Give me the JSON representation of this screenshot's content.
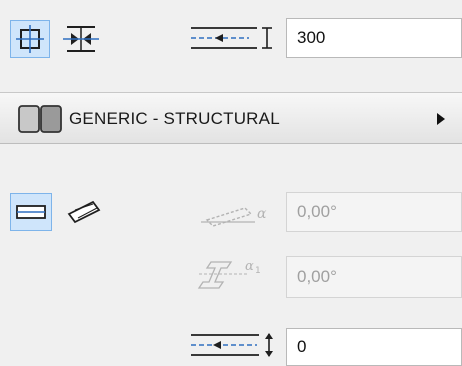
{
  "anchor": {
    "center_icon": "anchor-center-icon",
    "symmetric_icon": "anchor-symmetric-icon"
  },
  "height_field": {
    "icon": "height-dimension-icon",
    "value": "300"
  },
  "profile": {
    "icon": "profile-swatch-icon",
    "label": "GENERIC - STRUCTURAL",
    "menu_icon": "submenu-arrow-icon"
  },
  "orientation": {
    "horizontal_icon": "horizontal-beam-icon",
    "slanted_icon": "slanted-beam-icon"
  },
  "slant_angle": {
    "icon": "slant-angle-icon",
    "value": "0,00°"
  },
  "tilt_angle": {
    "icon": "tilt-angle-icon",
    "value": "0,00°"
  },
  "offset_field": {
    "icon": "offset-dimension-icon",
    "value": "0"
  },
  "colors": {
    "active_fill": "#cfe5fb",
    "active_border": "#7eb4ea",
    "icon_blue": "#2f6fc0"
  }
}
